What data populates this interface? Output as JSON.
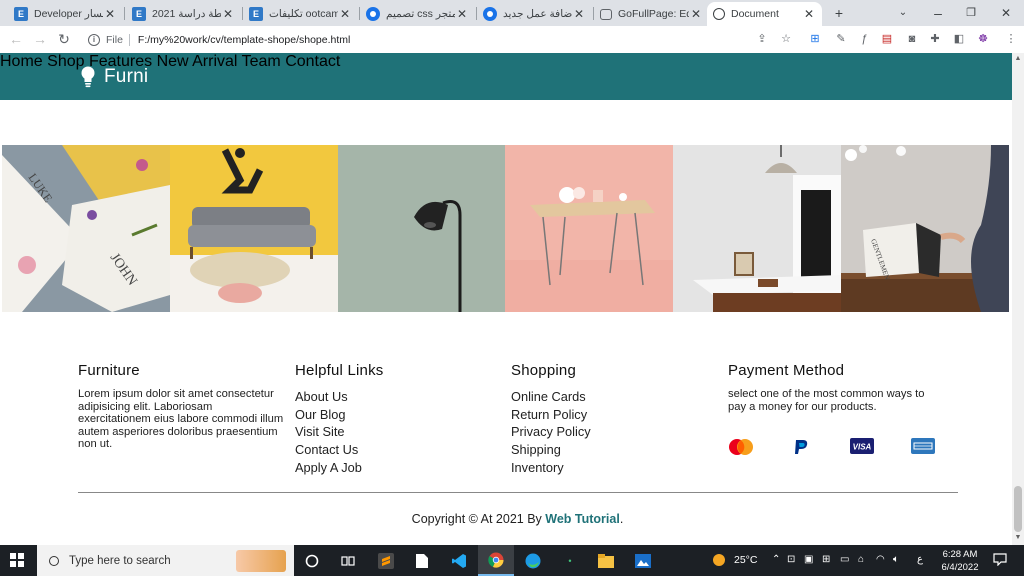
{
  "browser": {
    "tabs": [
      {
        "icon": "elementor-icon",
        "title": "Developer مسار"
      },
      {
        "icon": "elementor-icon",
        "title": "خطة دراسة 2021"
      },
      {
        "icon": "elementor-icon",
        "title": "تكليفات ootcamp"
      },
      {
        "icon": "circle-icon",
        "title": "تصميم css لمتجر"
      },
      {
        "icon": "circle-icon",
        "title": "إضافة عمل جديد"
      },
      {
        "icon": "camera-icon",
        "title": "GoFullPage: Edit"
      },
      {
        "icon": "globe-icon",
        "title": "Document"
      }
    ],
    "address_prefix": "File",
    "address": "F:/my%20work/cv/template-shope/shope.html"
  },
  "site": {
    "brand": "Furni",
    "nav": [
      "Home",
      "Shop",
      "Features",
      "New Arrival",
      "Team",
      "Contact"
    ],
    "gallery": [
      "card-photo",
      "sofa-photo",
      "lamp-photo",
      "table-photo",
      "room-photo",
      "magazine-photo"
    ],
    "gallery_text": {
      "card_luke": "LUKE",
      "card_john": "JOHN",
      "magazine": "GENTLEMEN"
    },
    "footer": {
      "furniture": {
        "title": "Furniture",
        "text": "Lorem ipsum dolor sit amet consectetur adipisicing elit. Laboriosam exercitationem eius labore commodi illum autem asperiores doloribus praesentium non ut."
      },
      "helpful": {
        "title": "Helpful Links",
        "links": [
          "About Us",
          "Our Blog",
          "Visit Site",
          "Contact Us",
          "Apply A Job"
        ]
      },
      "shopping": {
        "title": "Shopping",
        "links": [
          "Online Cards",
          "Return Policy",
          "Privacy Policy",
          "Shipping",
          "Inventory"
        ]
      },
      "payment": {
        "title": "Payment Method",
        "text": "select one of the most common ways to pay a money for our products.",
        "methods": [
          "mastercard-icon",
          "paypal-icon",
          "visa-icon",
          "amex-icon"
        ],
        "labels": {
          "visa": "VISA"
        }
      }
    },
    "copyright": {
      "prefix": "Copyright © At 2021 By",
      "link": "Web Tutorial",
      "suffix": "."
    },
    "colors": {
      "primary": "#1f7278"
    }
  },
  "taskbar": {
    "search_placeholder": "Type here to search",
    "weather": "25°C",
    "lang": "ع",
    "time": "6:28 AM",
    "date": "6/4/2022"
  }
}
